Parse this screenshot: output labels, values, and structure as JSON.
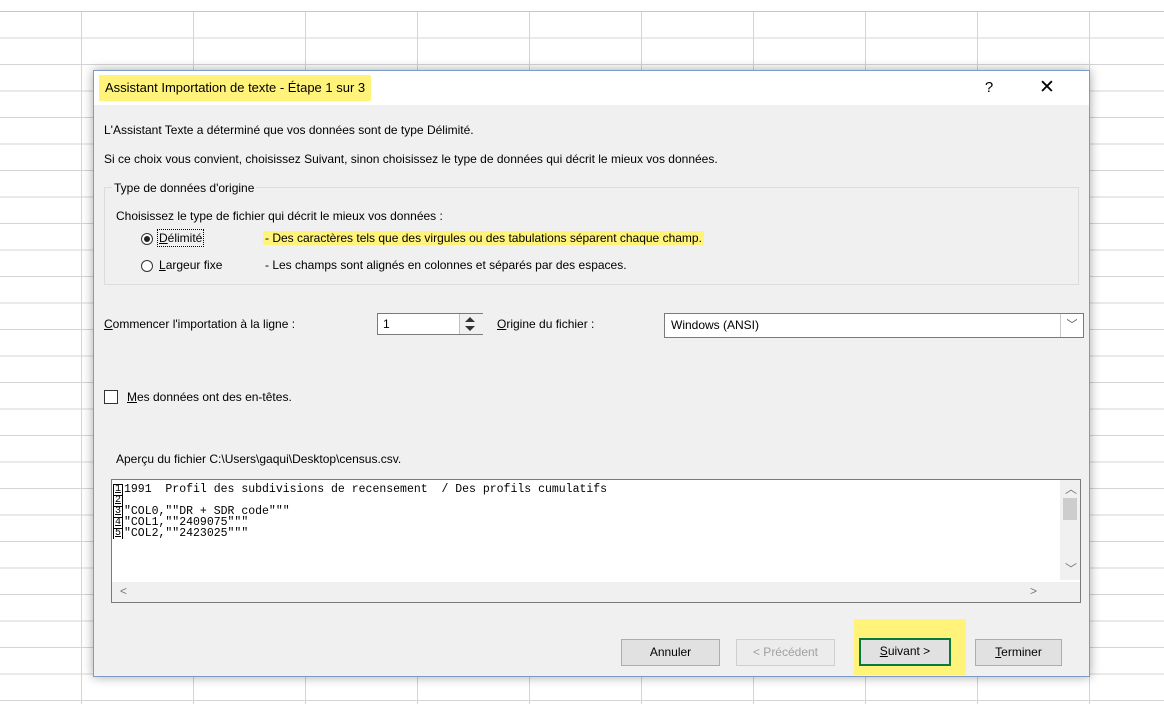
{
  "dialog": {
    "title": "Assistant Importation de texte - Étape 1 sur 3",
    "help_label": "?",
    "close_label": "✕",
    "intro_line1": "L'Assistant Texte a déterminé que vos données sont de type Délimité.",
    "intro_line2": "Si ce choix vous convient, choisissez Suivant, sinon choisissez le type de données qui décrit le mieux vos données."
  },
  "data_type": {
    "group_label": "Type de données d'origine",
    "instruction": "Choisissez le type de fichier qui décrit le mieux vos données :",
    "options": [
      {
        "accel": "D",
        "rest": "élimité",
        "description": "- Des caractères tels que des virgules ou des tabulations séparent chaque champ.",
        "selected": true
      },
      {
        "accel": "L",
        "rest": "argeur fixe",
        "description": "- Les champs sont alignés en colonnes et séparés par des espaces.",
        "selected": false
      }
    ]
  },
  "start_row": {
    "label_accel": "C",
    "label_rest": "ommencer l'importation à la ligne :",
    "value": "1"
  },
  "origin": {
    "label_accel": "O",
    "label_rest": "rigine du fichier :",
    "value": "Windows (ANSI)"
  },
  "headers": {
    "label_accel": "M",
    "label_rest": "es données ont des en-têtes.",
    "checked": false
  },
  "preview": {
    "label": "Aperçu du fichier C:\\Users\\gaqui\\Desktop\\census.csv.",
    "lines": [
      {
        "num": "1",
        "text": "1991  Profil des subdivisions de recensement  / Des profils cumulatifs"
      },
      {
        "num": "2",
        "text": ""
      },
      {
        "num": "3",
        "text": "\"COL0,\"\"DR + SDR code\"\"\""
      },
      {
        "num": "4",
        "text": "\"COL1,\"\"2409075\"\"\""
      },
      {
        "num": "5",
        "text": "\"COL2,\"\"2423025\"\"\""
      }
    ]
  },
  "buttons": {
    "cancel": "Annuler",
    "previous": "< Précédent",
    "next_accel": "S",
    "next_rest": "uivant >",
    "finish_accel": "T",
    "finish_rest": "erminer"
  },
  "colors": {
    "highlight": "#fff37a",
    "next_border": "#0a7a3c"
  }
}
